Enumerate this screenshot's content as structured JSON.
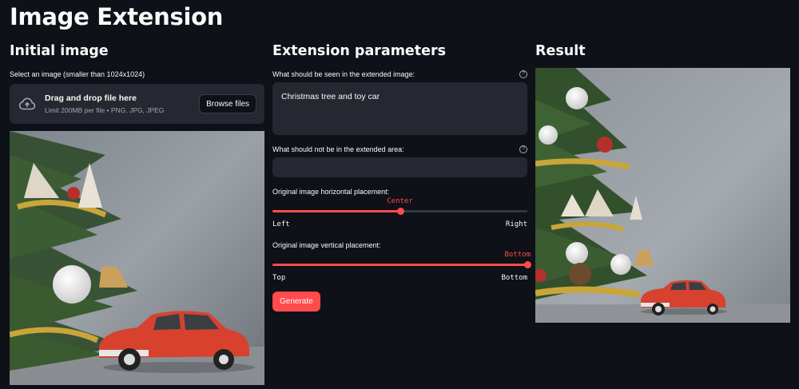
{
  "page": {
    "title": "Image Extension"
  },
  "left": {
    "title": "Initial image",
    "upload_label": "Select an image (smaller than 1024x1024)",
    "uploader": {
      "main_text": "Drag and drop file here",
      "sub_text": "Limit 200MB per file • PNG, JPG, JPEG",
      "browse_label": "Browse files",
      "icon": "cloud-upload-icon"
    }
  },
  "middle": {
    "title": "Extension parameters",
    "positive": {
      "label": "What should be seen in the extended image:",
      "value": "Christmas tree and toy car",
      "help_icon": "question-circle-icon"
    },
    "negative": {
      "label": "What should not be in the extended area:",
      "value": "",
      "help_icon": "question-circle-icon"
    },
    "horizontal": {
      "label": "Original image horizontal placement:",
      "value": "Center",
      "min": "Left",
      "max": "Right",
      "position": 0.5
    },
    "vertical": {
      "label": "Original image vertical placement:",
      "value": "Bottom",
      "min": "Top",
      "max": "Bottom",
      "position": 1.0
    },
    "generate_label": "Generate"
  },
  "right": {
    "title": "Result"
  },
  "colors": {
    "accent": "#ff4b4b",
    "background": "#0e1117",
    "surface": "#262730"
  }
}
